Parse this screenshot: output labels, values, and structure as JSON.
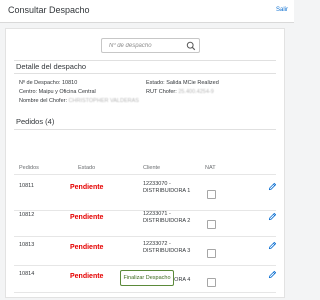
{
  "header": {
    "title": "Consultar Despacho",
    "exit_label": "Salir"
  },
  "search": {
    "placeholder": "Nº de despacho"
  },
  "detail": {
    "title": "Detalle del despacho",
    "numero_label": "Nº de Despacho:",
    "numero_value": "10810",
    "estado_label": "Estado:",
    "estado_value": "Salida MCie Realized",
    "centro_label": "Centro:",
    "centro_value": "Maipu y Oficina Central",
    "rut_label": "RUT Chofer:",
    "rut_value": "25.400.4254-9",
    "chofer_label": "Nombre del Chofer:",
    "chofer_value": "CHRISTOPHER VALDERAS"
  },
  "pedidos": {
    "title": "Pedidos (4)",
    "columns": [
      "Pedidos",
      "Estado",
      "Cliente",
      "NAT"
    ],
    "rows": [
      {
        "id": "10811",
        "estado": "Pendiente",
        "cliente_code": "12233070 -",
        "cliente_name": "DISTRIBUIDORA 1",
        "nat": false
      },
      {
        "id": "10812",
        "estado": "Pendiente",
        "cliente_code": "12233071 -",
        "cliente_name": "DISTRIBUIDORA 2",
        "nat": false
      },
      {
        "id": "10813",
        "estado": "Pendiente",
        "cliente_code": "12233072 -",
        "cliente_name": "DISTRIBUIDORA 3",
        "nat": false
      },
      {
        "id": "10814",
        "estado": "Pendiente",
        "cliente_code": "12233073 -",
        "cliente_name": "DISTRIBUIDORA 4",
        "nat": false
      }
    ]
  },
  "footer": {
    "finalize_label": "Finalizar Despacho"
  },
  "colors": {
    "accent": "#0a6ed1",
    "status_pending": "#e50000",
    "finalize_border": "#5b8a3a"
  },
  "icons": {
    "search": "search-icon",
    "edit": "pencil-icon"
  }
}
